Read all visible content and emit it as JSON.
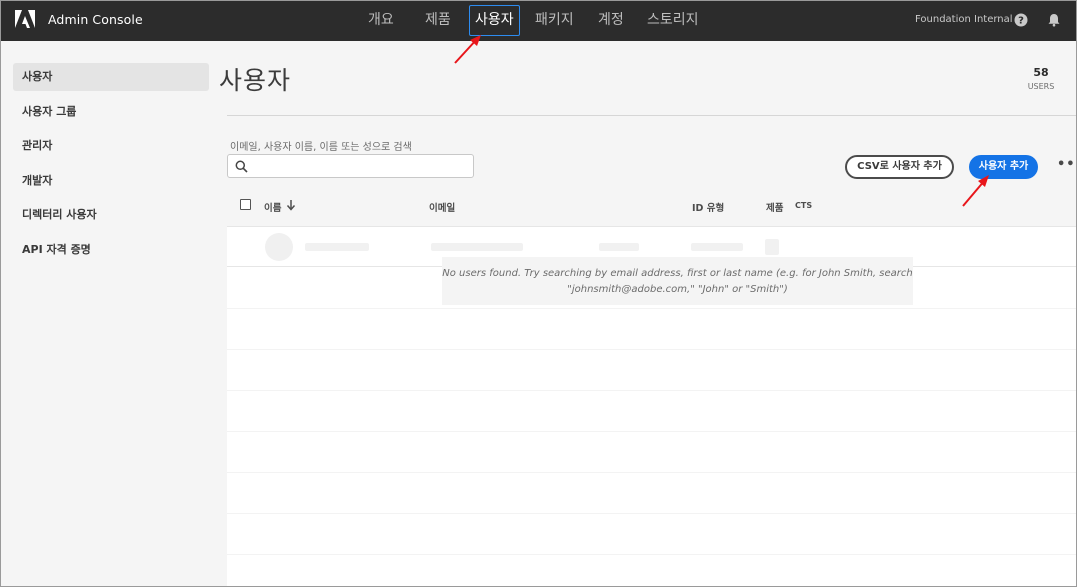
{
  "app": {
    "title": "Admin Console",
    "org_name": "Foundation Internal"
  },
  "nav": {
    "tabs": [
      {
        "label": "개요",
        "active": false
      },
      {
        "label": "제품",
        "active": false
      },
      {
        "label": "사용자",
        "active": true
      },
      {
        "label": "패키지",
        "active": false
      },
      {
        "label": "계정",
        "active": false
      },
      {
        "label": "스토리지",
        "active": false
      }
    ]
  },
  "icons": {
    "logo": "adobe-logo-icon",
    "help": "help-icon",
    "notifications": "bell-icon",
    "search": "search-icon",
    "more": "more-icon",
    "sort": "sort-down-icon"
  },
  "sidebar": {
    "items": [
      {
        "label": "사용자",
        "active": true
      },
      {
        "label": "사용자 그룹",
        "active": false
      },
      {
        "label": "관리자",
        "active": false
      },
      {
        "label": "개발자",
        "active": false
      },
      {
        "label": "디렉터리 사용자",
        "active": false
      },
      {
        "label": "API 자격 증명",
        "active": false
      }
    ]
  },
  "main": {
    "title": "사용자",
    "count": "58",
    "count_label": "USERS",
    "search": {
      "label": "이메일, 사용자 이름, 이름 또는 성으로 검색",
      "value": "",
      "placeholder": ""
    },
    "buttons": {
      "add_csv": "CSV로 사용자 추가",
      "add_user": "사용자 추가",
      "more": "•••"
    },
    "table": {
      "columns": [
        "이름",
        "이메일",
        "ID 유형",
        "제품",
        "CTS"
      ]
    },
    "empty_message": "No users found. Try searching by email address, first or last name (e.g. for John Smith, search \"johnsmith@adobe.com,\" \"John\" or \"Smith\")"
  },
  "colors": {
    "topbar": "#2c2c2c",
    "accent": "#1473e6",
    "active_tab_border": "#2d8cf0",
    "annotation": "#e8161b"
  }
}
